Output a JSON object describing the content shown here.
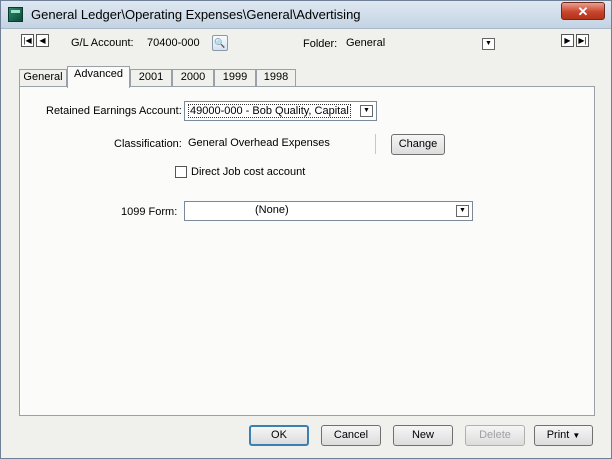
{
  "window": {
    "title": "General Ledger\\Operating Expenses\\General\\Advertising",
    "close_glyph": "✕"
  },
  "header": {
    "gl_account_label": "G/L Account:",
    "gl_account_value": "70400-000",
    "folder_label": "Folder:",
    "folder_value": "General"
  },
  "tabs": [
    {
      "label": "General"
    },
    {
      "label": "Advanced"
    },
    {
      "label": "2001"
    },
    {
      "label": "2000"
    },
    {
      "label": "1999"
    },
    {
      "label": "1998"
    }
  ],
  "active_tab": "Advanced",
  "advanced": {
    "retained_earnings_label": "Retained Earnings Account:",
    "retained_earnings_value": "49000-000 - Bob Quality, Capital",
    "classification_label": "Classification:",
    "classification_value": "General Overhead Expenses",
    "change_label": "Change",
    "direct_job_cost_label": "Direct Job cost account",
    "direct_job_cost_checked": false,
    "form1099_label": "1099 Form:",
    "form1099_value": "(None)"
  },
  "footer": {
    "ok": "OK",
    "cancel": "Cancel",
    "new": "New",
    "delete": "Delete",
    "print": "Print"
  },
  "icons": {
    "first_record": "first-record-icon",
    "prev_record": "prev-record-icon",
    "next_record": "next-record-icon",
    "last_record": "last-record-icon",
    "lookup": "magnifier-icon"
  },
  "colors": {
    "title_bar": "#c4d3e3",
    "close_button": "#c9452d",
    "default_button_border": "#3c7fb1"
  }
}
